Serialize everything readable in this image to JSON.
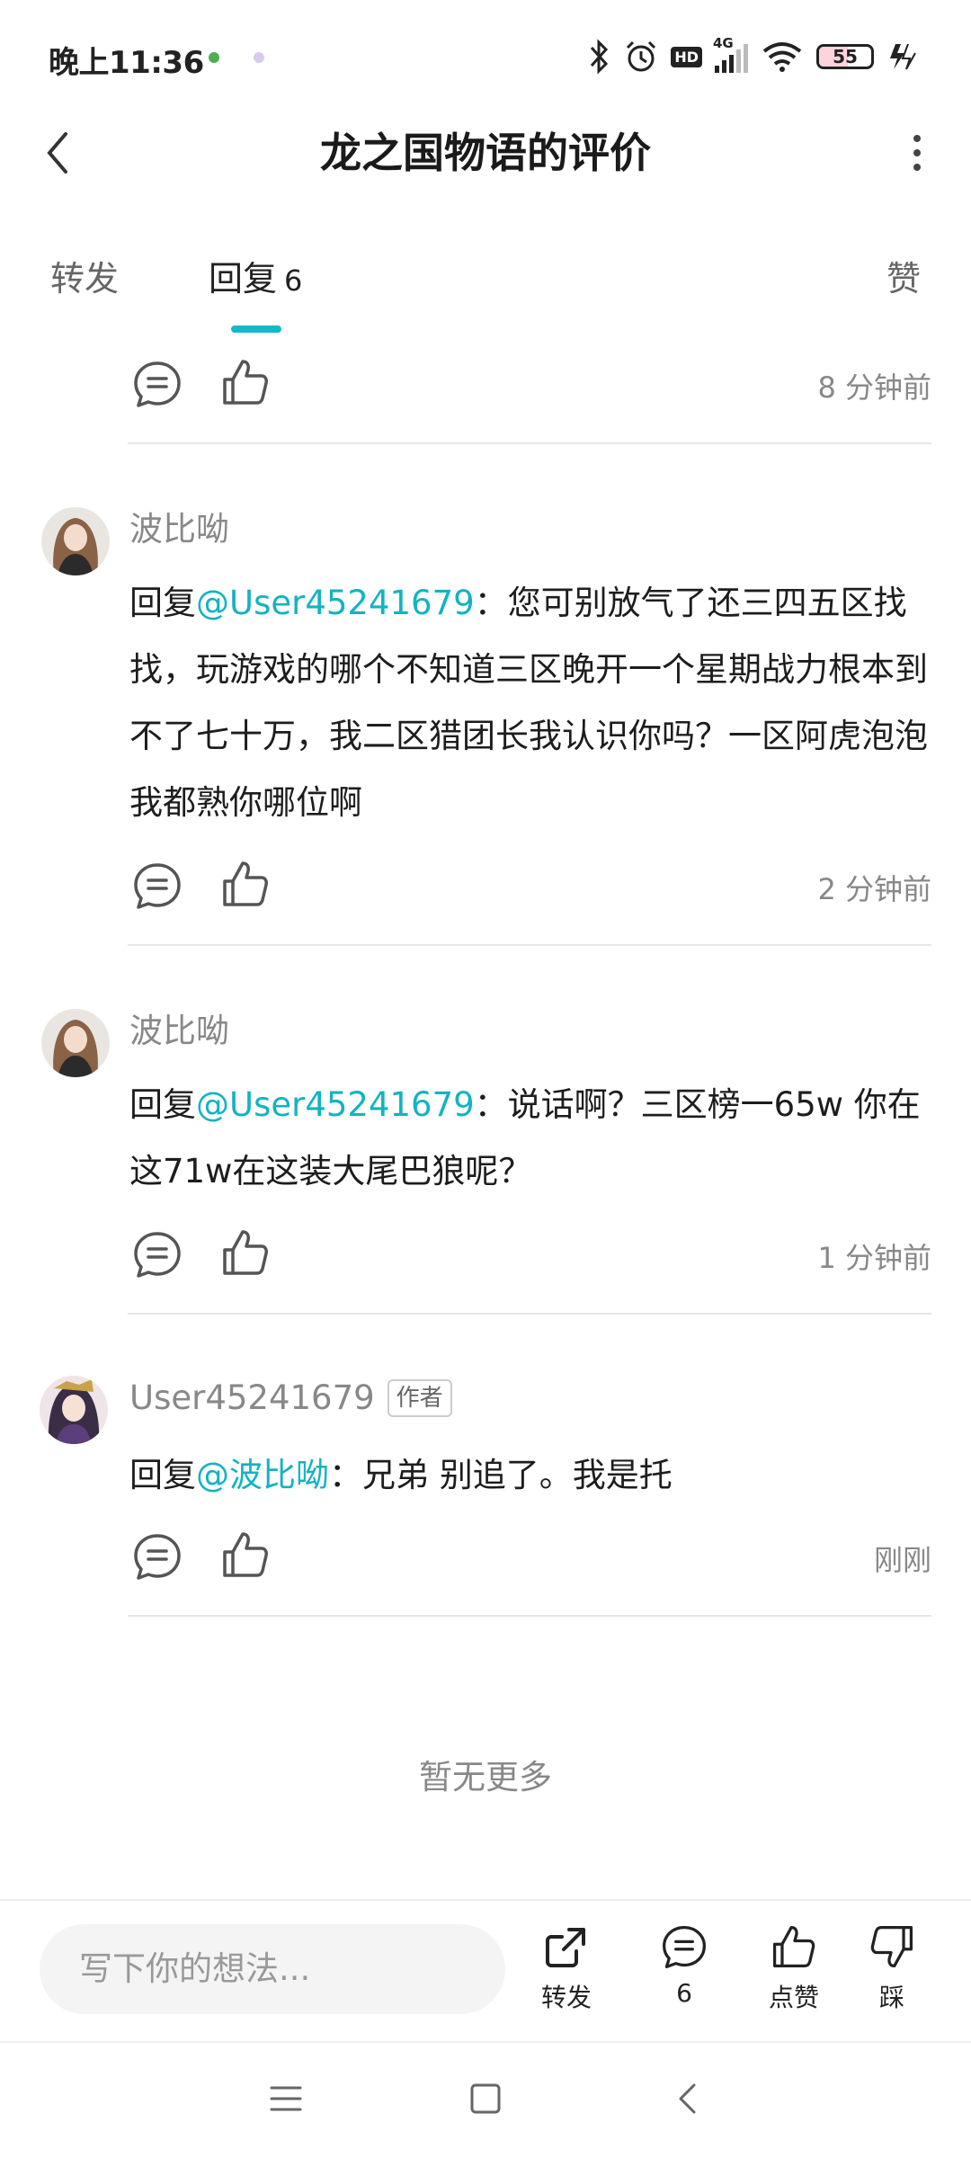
{
  "status_bar": {
    "time": "晚上11:36",
    "network": "4G",
    "hd": "HD",
    "battery": "55"
  },
  "header": {
    "title": "龙之国物语的评价"
  },
  "tabs": {
    "forward": "转发",
    "reply": "回复",
    "reply_count": "6",
    "like": "赞"
  },
  "top_item": {
    "time": "8 分钟前"
  },
  "comments": [
    {
      "username": "波比呦",
      "prefix": "回复",
      "mention": "@User45241679",
      "text": "：您可别放气了还三四五区找找，玩游戏的哪个不知道三区晚开一个星期战力根本到不了七十万，我二区猎团长我认识你吗？一区阿虎泡泡我都熟你哪位啊",
      "time": "2 分钟前"
    },
    {
      "username": "波比呦",
      "prefix": "回复",
      "mention": "@User45241679",
      "text": "：说话啊？三区榜一65w 你在这71w在这装大尾巴狼呢？",
      "time": "1 分钟前"
    },
    {
      "username": "User45241679",
      "badge": "作者",
      "prefix": "回复",
      "mention": "@波比呦",
      "text": "：兄弟 别追了。我是托",
      "time": "刚刚"
    }
  ],
  "no_more": "暂无更多",
  "bottom_bar": {
    "input_placeholder": "写下你的想法...",
    "forward_label": "转发",
    "comment_count": "6",
    "like_label": "点赞",
    "dislike_label": "踩"
  },
  "colors": {
    "accent": "#14b9c8",
    "mention": "#13b3c2"
  }
}
